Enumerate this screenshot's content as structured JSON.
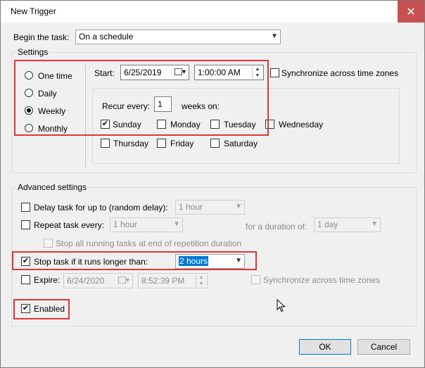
{
  "window": {
    "title": "New Trigger",
    "close_glyph": "✕"
  },
  "begin": {
    "label": "Begin the task:",
    "value": "On a schedule"
  },
  "settings": {
    "label": "Settings",
    "options": [
      {
        "label": "One time",
        "selected": false
      },
      {
        "label": "Daily",
        "selected": false
      },
      {
        "label": "Weekly",
        "selected": true
      },
      {
        "label": "Monthly",
        "selected": false
      }
    ],
    "start_label": "Start:",
    "start_date": "6/25/2019",
    "start_time": "1:00:00 AM",
    "sync_label": "Synchronize across time zones",
    "recur_label": "Recur every:",
    "recur_value": "1",
    "weeks_on_label": "weeks on:",
    "days": [
      {
        "label": "Sunday",
        "checked": true
      },
      {
        "label": "Monday",
        "checked": false
      },
      {
        "label": "Tuesday",
        "checked": false
      },
      {
        "label": "Wednesday",
        "checked": false
      },
      {
        "label": "Thursday",
        "checked": false
      },
      {
        "label": "Friday",
        "checked": false
      },
      {
        "label": "Saturday",
        "checked": false
      }
    ]
  },
  "advanced": {
    "label": "Advanced settings",
    "delay_label": "Delay task for up to (random delay):",
    "delay_value": "1 hour",
    "repeat_label": "Repeat task every:",
    "repeat_value": "1 hour",
    "duration_label": "for a duration of:",
    "duration_value": "1 day",
    "stop_all_label": "Stop all running tasks at end of repetition duration",
    "stop_longer_label": "Stop task if it runs longer than:",
    "stop_longer_value": "2 hours",
    "expire_label": "Expire:",
    "expire_date": "6/24/2020",
    "expire_time": "8:52:39 PM",
    "expire_sync_label": "Synchronize across time zones",
    "enabled_label": "Enabled"
  },
  "buttons": {
    "ok": "OK",
    "cancel": "Cancel"
  },
  "colors": {
    "highlight": "#e0353a",
    "selection": "#0078d7"
  }
}
